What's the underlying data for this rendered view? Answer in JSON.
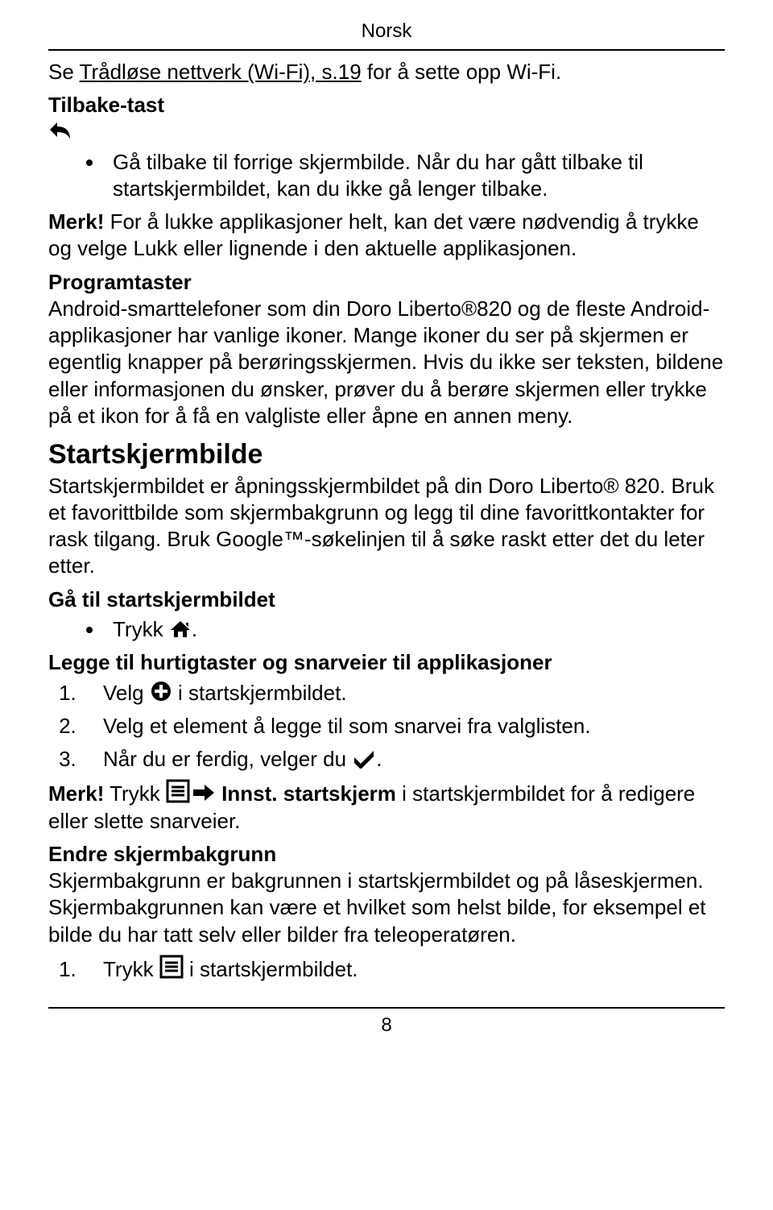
{
  "lang_header": "Norsk",
  "intro": {
    "prefix": "Se ",
    "link": "Trådløse nettverk (Wi-Fi), s.19",
    "suffix": " for å sette opp Wi-Fi."
  },
  "tilbake": {
    "heading": "Tilbake-tast",
    "bullet": "Gå tilbake til forrige skjermbilde. Når du har gått tilbake til startskjermbildet, kan du ikke gå lenger tilbake.",
    "note_prefix": "Merk!",
    "note_body": "  For å lukke applikasjoner helt, kan det være nødvendig å trykke og velge Lukk eller lignende i den aktuelle applikasjonen."
  },
  "programtaster": {
    "heading": "Programtaster",
    "body": "Android-smarttelefoner som din Doro Liberto®820 og de fleste Android-applikasjoner har vanlige ikoner. Mange ikoner du ser på skjermen er egentlig knapper på berøringsskjermen. Hvis du ikke ser teksten, bildene eller informasjonen du ønsker, prøver du å berøre skjermen eller trykke på et ikon for å få en valgliste eller åpne en annen meny."
  },
  "startskjermbilde": {
    "heading": "Startskjermbilde",
    "body": "Startskjermbildet er åpningsskjermbildet på din Doro Liberto® 820. Bruk et favorittbilde som skjermbakgrunn og legg til dine favorittkontakter for rask tilgang. Bruk Google™-søkelinjen til å søke raskt etter det du leter etter."
  },
  "gaa_til": {
    "heading": "Gå til startskjermbildet",
    "bullet_prefix": "Trykk ",
    "bullet_suffix": "."
  },
  "legge_til": {
    "heading": "Legge til hurtigtaster og snarveier til applikasjoner",
    "item1_prefix": "Velg ",
    "item1_suffix": " i startskjermbildet.",
    "item2": "Velg et element å legge til som snarvei fra valglisten.",
    "item3_prefix": "Når du er ferdig, velger du ",
    "item3_suffix": "."
  },
  "merk2": {
    "prefix": "Merk!",
    "trykk": "  Trykk ",
    "innst": " Innst. startskjerm",
    "rest": " i startskjermbildet for å redigere eller slette snarveier."
  },
  "endre": {
    "heading": "Endre skjermbakgrunn",
    "body": "Skjermbakgrunn er bakgrunnen i startskjermbildet og på låseskjermen. Skjermbakgrunnen kan være et hvilket som helst bilde, for eksempel et bilde du har tatt selv eller bilder fra teleoperatøren.",
    "item1_prefix": "Trykk ",
    "item1_suffix": " i startskjermbildet."
  },
  "page_number": "8"
}
